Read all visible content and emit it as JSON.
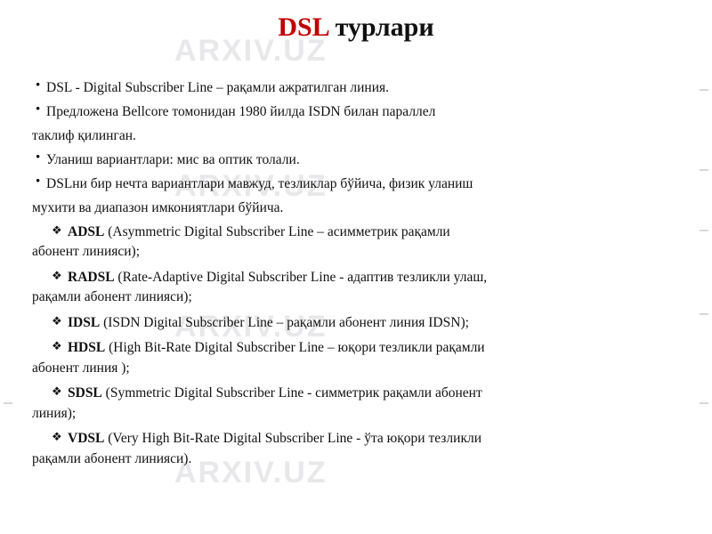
{
  "slide": {
    "title_main": "DSL",
    "title_rest": " турлари",
    "watermark": "ARXIV.UZ",
    "bullets": [
      {
        "marker": "•",
        "text": "DSL - Digital Subscriber Line – рақамли   ажратилган линия."
      },
      {
        "marker": "•",
        "text": "Предложена Bellcore томонидан 1980 йилда ISDN билан параллел",
        "cont": "таклиф қилинган."
      },
      {
        "marker": "•",
        "text": " Уланиш вариантлари: мис ва оптик толали."
      },
      {
        "marker": "•",
        "text": "DSLни бир нечта вариантлари мавжуд, тезликлар бўйича, физик уланиш",
        "cont": "мухити ва диапазон имкониятлари бўйича."
      }
    ],
    "definitions": [
      {
        "marker": "❖",
        "abbr": "ADSL",
        "line1": " (Asymmetric  Digital  Subscriber  Line  –  асимметрик  рақамли",
        "line2": "абонент линияси);"
      },
      {
        "marker": "❖",
        "abbr": "RADSL",
        "line1": " (Rate-Adaptive Digital Subscriber Line - адаптив тезликли улаш,",
        "line2": "рақамли абонент линияси);"
      },
      {
        "marker": "❖",
        "abbr": "IDSL",
        "line1": " (ISDN Digital Subscriber Line – рақамли абонент линия IDSN);",
        "line2": ""
      },
      {
        "marker": "❖",
        "abbr": "HDSL",
        "line1": " (High  Bit-Rate  Digital  Subscriber  Line  –  юқори  тезликли  рақамли",
        "line2": "абонент линия );"
      },
      {
        "marker": "❖",
        "abbr": "SDSL",
        "line1": " (Symmetric  Digital  Subscriber  Line  -  симметрик  рақамли  абонент",
        "line2": "линия);"
      },
      {
        "marker": "❖",
        "abbr": "VDSL",
        "line1": " (Very High Bit-Rate Digital Subscriber Line - ўта  юқори  тезликли",
        "line2": "рақамли  абонент  линияси)."
      }
    ]
  }
}
